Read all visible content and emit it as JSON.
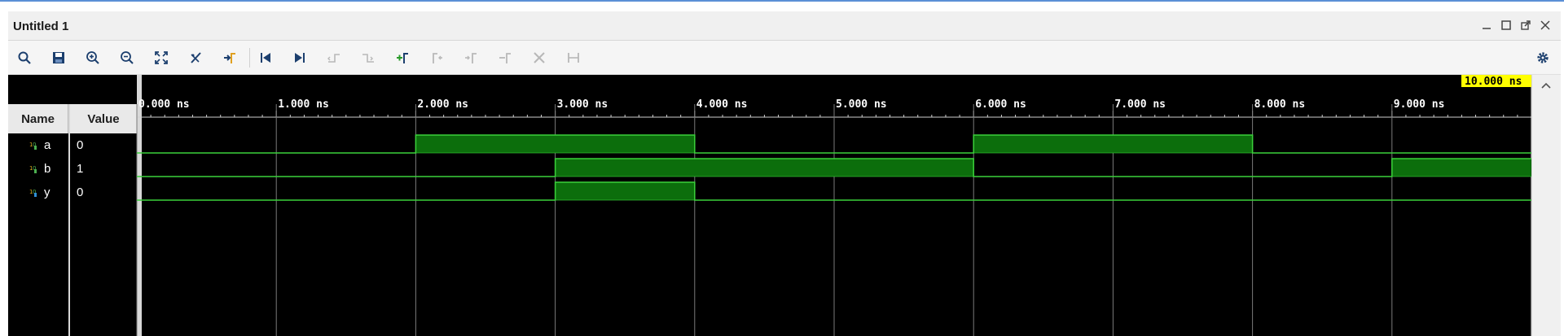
{
  "window": {
    "title": "Untitled 1",
    "controls": [
      "minimize-icon",
      "maximize-icon",
      "float-icon",
      "close-icon"
    ]
  },
  "toolbar": {
    "buttons": [
      {
        "name": "search-icon",
        "enabled": true
      },
      {
        "name": "save-icon",
        "enabled": true
      },
      {
        "name": "zoom-in-icon",
        "enabled": true
      },
      {
        "name": "zoom-out-icon",
        "enabled": true
      },
      {
        "name": "zoom-fit-icon",
        "enabled": true
      },
      {
        "name": "go-to-cursor-icon",
        "enabled": true
      },
      {
        "name": "add-marker-icon",
        "enabled": true
      },
      {
        "name": "go-to-time-zero-icon",
        "enabled": true
      },
      {
        "name": "go-to-last-time-icon",
        "enabled": true
      },
      {
        "name": "previous-transition-icon",
        "enabled": false
      },
      {
        "name": "next-transition-icon",
        "enabled": false
      },
      {
        "name": "add-marker-plus-icon",
        "enabled": true
      },
      {
        "name": "previous-marker-icon",
        "enabled": false
      },
      {
        "name": "next-marker-icon",
        "enabled": false
      },
      {
        "name": "swap-cursors-icon",
        "enabled": false
      },
      {
        "name": "delete-icon",
        "enabled": false
      },
      {
        "name": "snap-icon",
        "enabled": false
      }
    ],
    "settings_icon": "gear-icon"
  },
  "waveform": {
    "columns": {
      "name": "Name",
      "value": "Value"
    },
    "cursor_time": "10.000 ns",
    "time_unit": "ns",
    "time_range": [
      0,
      10
    ],
    "time_labels": [
      "0.000 ns",
      "1.000 ns",
      "2.000 ns",
      "3.000 ns",
      "4.000 ns",
      "5.000 ns",
      "6.000 ns",
      "7.000 ns",
      "8.000 ns",
      "9.000 ns"
    ],
    "signals": [
      {
        "name": "a",
        "value": "0",
        "transitions": [
          [
            0,
            0
          ],
          [
            2,
            1
          ],
          [
            4,
            0
          ],
          [
            6,
            1
          ],
          [
            8,
            0
          ]
        ]
      },
      {
        "name": "b",
        "value": "1",
        "transitions": [
          [
            0,
            0
          ],
          [
            3,
            1
          ],
          [
            6,
            0
          ],
          [
            9,
            1
          ]
        ]
      },
      {
        "name": "y",
        "value": "0",
        "transitions": [
          [
            0,
            0
          ],
          [
            3,
            1
          ],
          [
            4,
            0
          ]
        ]
      }
    ],
    "colors": {
      "signal": "#3ad13a",
      "signal_high_fill": "#0c6e0c",
      "grid": "#7a7a7a",
      "cursor_label_bg": "#ffff00",
      "background": "#000000"
    }
  }
}
